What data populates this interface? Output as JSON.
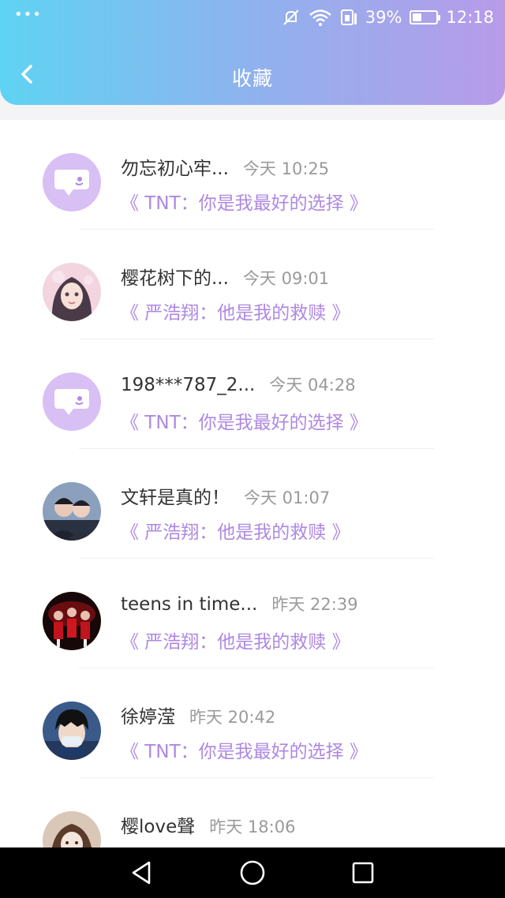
{
  "status": {
    "battery": "39%",
    "battery_level": 0.39,
    "time": "12:18"
  },
  "header": {
    "title": "收藏"
  },
  "items": [
    {
      "name": "勿忘初心牢...",
      "time": "今天 10:25",
      "title": "《 TNT：你是我最好的选择 》",
      "avatar": "default-avatar"
    },
    {
      "name": "樱花树下的...",
      "time": "今天 09:01",
      "title": "《 严浩翔：他是我的救赎 》",
      "avatar": "anime-girl-avatar"
    },
    {
      "name": "198***787_2...",
      "time": "今天 04:28",
      "title": "《 TNT：你是我最好的选择 》",
      "avatar": "default-avatar"
    },
    {
      "name": "文轩是真的！",
      "time": "今天 01:07",
      "title": "《 严浩翔：他是我的救赎 》",
      "avatar": "two-people-photo-avatar"
    },
    {
      "name": "teens in time...",
      "time": "昨天 22:39",
      "title": "《 严浩翔：他是我的救赎 》",
      "avatar": "group-photo-avatar"
    },
    {
      "name": "徐婷滢",
      "time": "昨天 20:42",
      "title": "《 TNT：你是我最好的选择 》",
      "avatar": "anime-boy-avatar"
    },
    {
      "name": "樱love聲",
      "time": "昨天 18:06",
      "title": "",
      "avatar": "anime-portrait-avatar"
    }
  ],
  "colors": {
    "header_gradient_start": "#5fd3f3",
    "header_gradient_end": "#b79be9",
    "accent_purple": "#ae88e2",
    "default_avatar_bg": "#d8bff4"
  }
}
